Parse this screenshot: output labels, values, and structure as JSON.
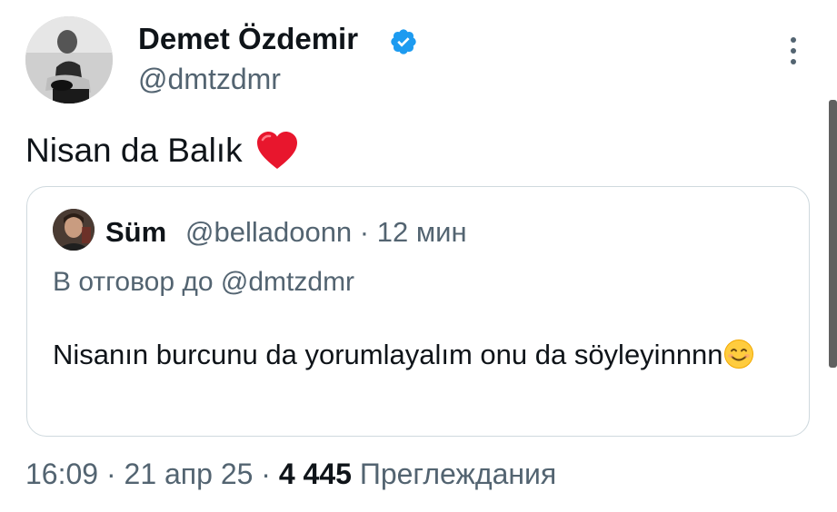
{
  "author": {
    "name": "Demet Özdemir",
    "handle": "@dmtzdmr",
    "verified": true,
    "avatar_icon": "avatar-photo"
  },
  "tweet": {
    "text": "Nisan da Balık",
    "emoji_icon": "red-heart-icon"
  },
  "quoted": {
    "name": "Süm",
    "handle": "@belladoonn",
    "separator": "·",
    "time": "12 мин",
    "reply_prefix": "В отговор до",
    "reply_to": "@dmtzdmr",
    "text": "Nisanın burcunu da yorumlayalım onu da söyleyinnnn",
    "emoji_icon": "smiling-face-icon"
  },
  "footer": {
    "time": "16:09",
    "separator": "·",
    "date": "21 апр 25",
    "views": "4 445",
    "views_label": "Преглеждания"
  },
  "colors": {
    "text_primary": "#0f1419",
    "text_secondary": "#536471",
    "verified_blue": "#1d9bf0",
    "border": "#cfd9de",
    "heart_red": "#e8162d"
  }
}
